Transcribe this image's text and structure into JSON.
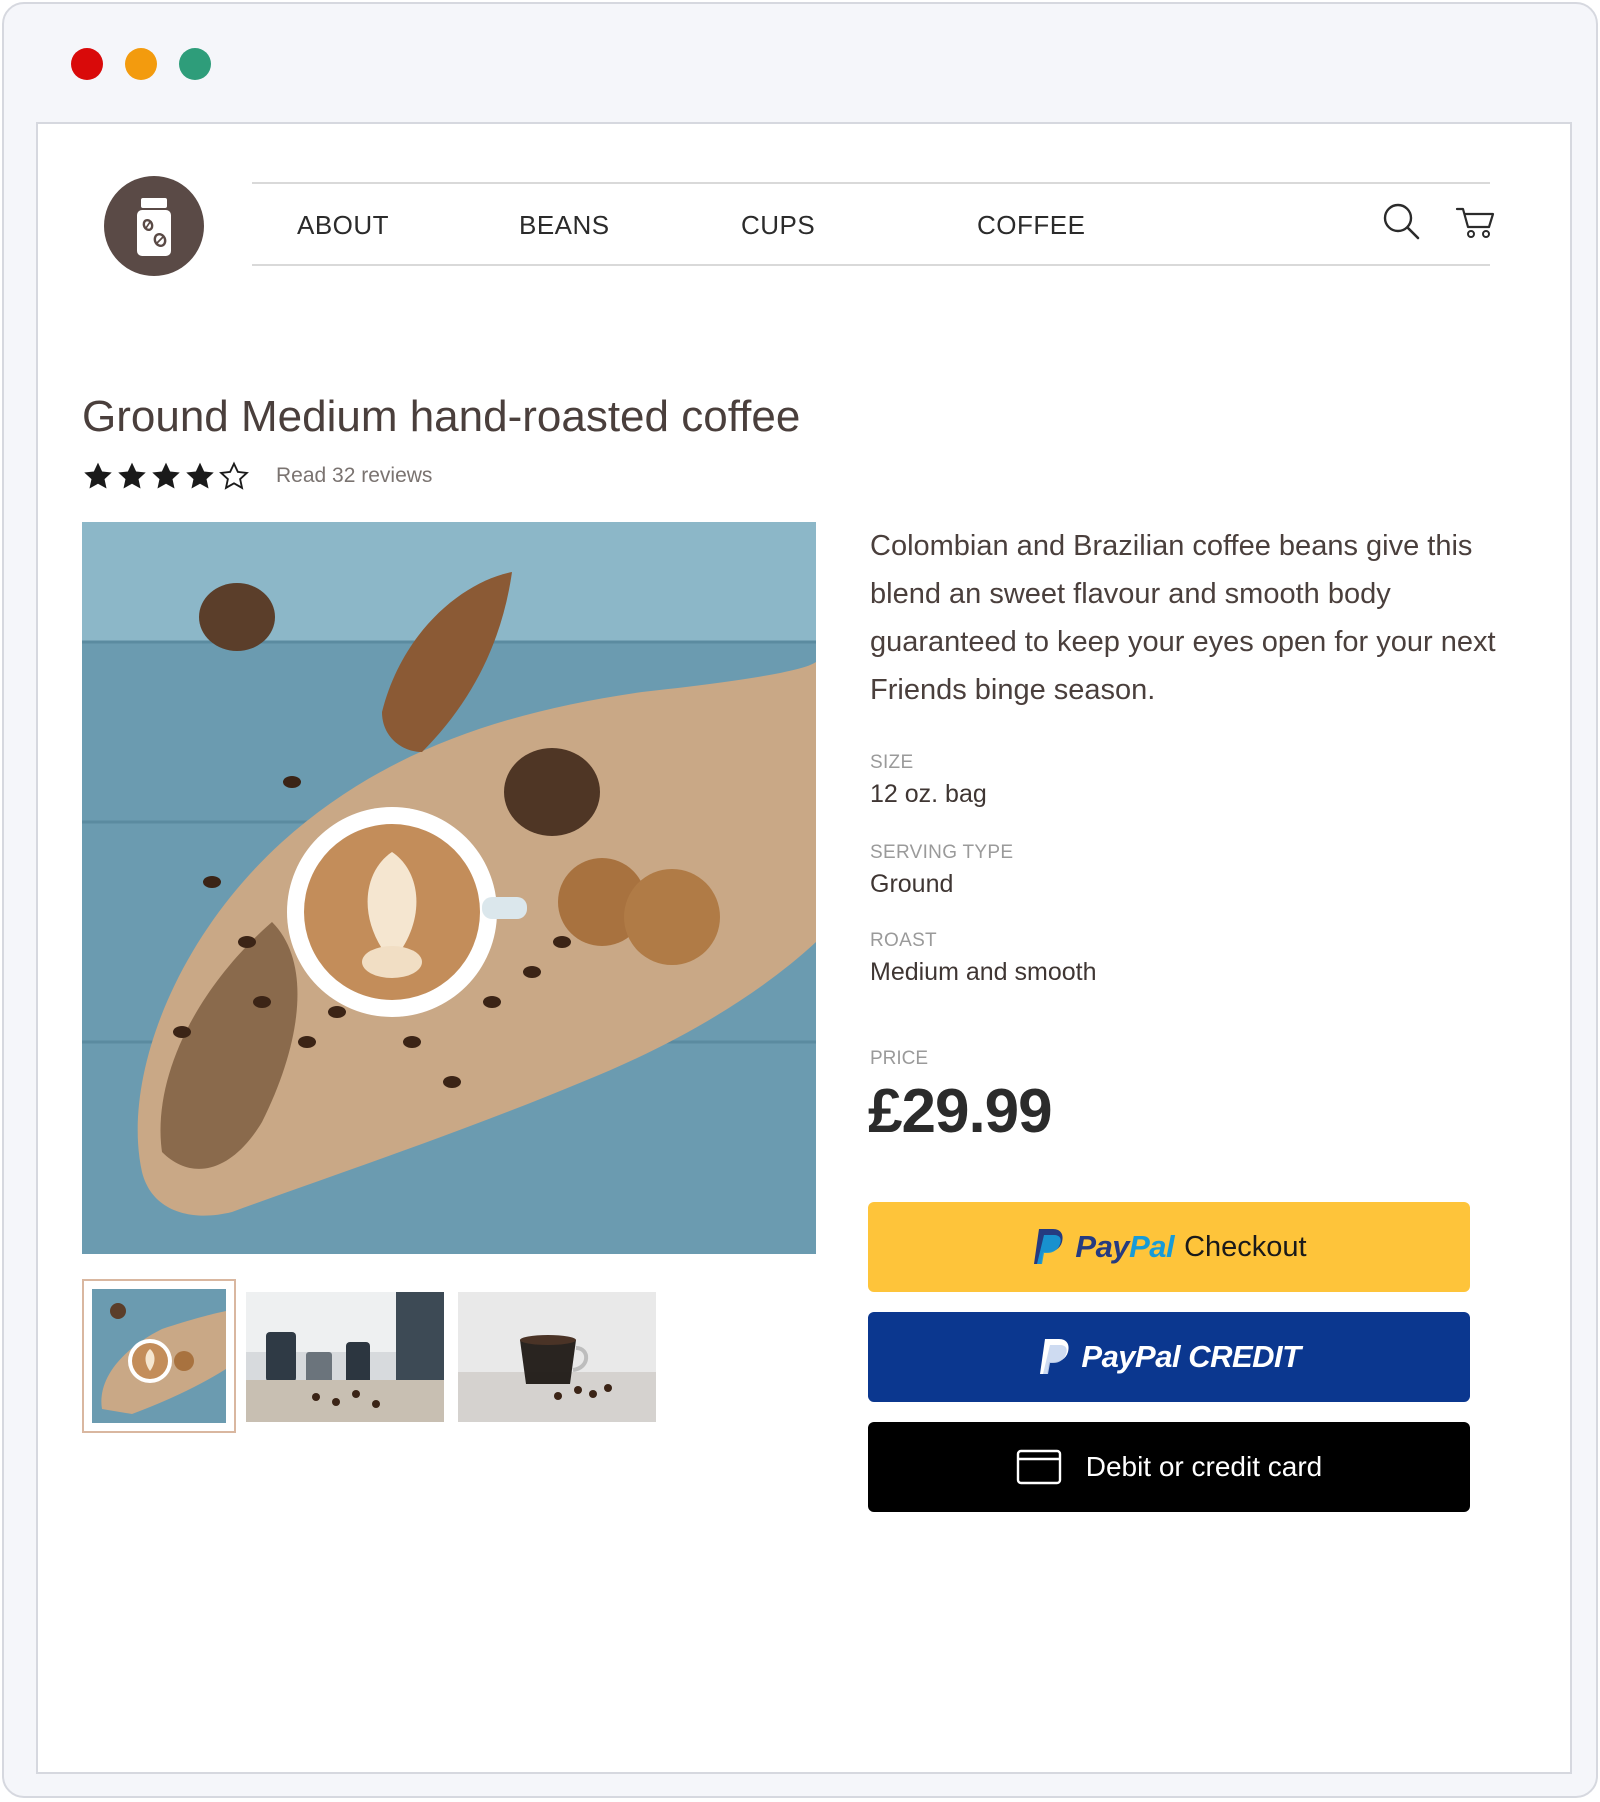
{
  "window": {
    "controls": [
      "close",
      "minimize",
      "maximize"
    ]
  },
  "header": {
    "logo_icon": "coffee-jar-icon",
    "nav": [
      {
        "label": "ABOUT"
      },
      {
        "label": "BEANS"
      },
      {
        "label": "CUPS"
      },
      {
        "label": "COFFEE"
      }
    ],
    "search_icon": "search-icon",
    "cart_icon": "cart-icon"
  },
  "product": {
    "title": "Ground Medium hand-roasted coffee",
    "rating": {
      "value": 4,
      "max": 5
    },
    "reviews_link": "Read 32 reviews",
    "description": "Colombian and Brazilian coffee beans give this blend an sweet flavour and smooth body guaranteed to keep your eyes open for your next Friends binge season.",
    "specs": [
      {
        "label": "SIZE",
        "value": "12 oz. bag"
      },
      {
        "label": "SERVING TYPE",
        "value": "Ground"
      },
      {
        "label": "ROAST",
        "value": "Medium and smooth"
      }
    ],
    "price_label": "PRICE",
    "price": "£29.99",
    "thumbnails": [
      {
        "name": "latte-on-board",
        "selected": true
      },
      {
        "name": "pour-over-setup",
        "selected": false
      },
      {
        "name": "espresso-cup",
        "selected": false
      }
    ]
  },
  "payment": {
    "checkout": {
      "pay": "Pay",
      "pal": "Pal",
      "label": "Checkout"
    },
    "credit": {
      "label": "PayPal CREDIT"
    },
    "card": {
      "label": "Debit or credit card"
    }
  },
  "colors": {
    "brand_brown": "#5a4a46",
    "paypal_yellow": "#fec43a",
    "paypal_blue": "#0b378f",
    "card_black": "#000000"
  }
}
